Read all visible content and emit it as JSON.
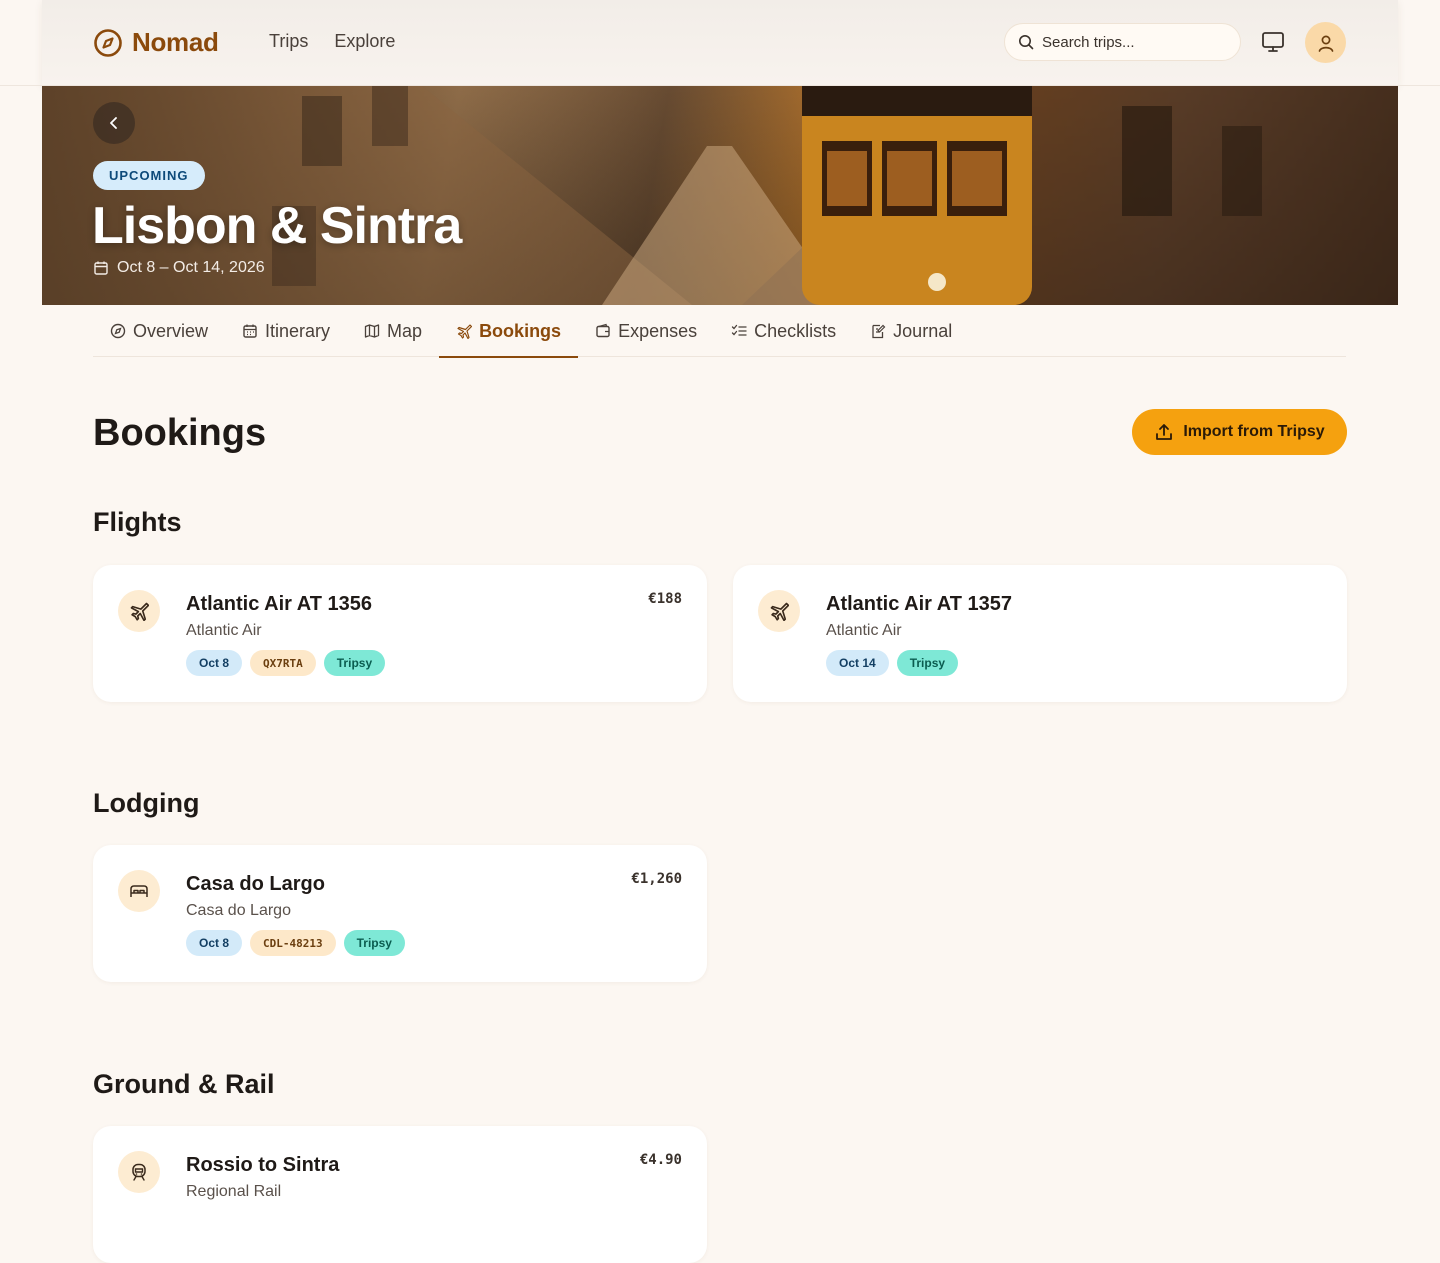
{
  "app": {
    "name": "Nomad"
  },
  "topnav": {
    "items": [
      "Trips",
      "Explore"
    ]
  },
  "search": {
    "placeholder": "Search trips..."
  },
  "hero": {
    "status": "UPCOMING",
    "title": "Lisbon & Sintra",
    "dates": "Oct 8 – Oct 14, 2026"
  },
  "tabs": [
    {
      "label": "Overview",
      "icon": "compass-icon"
    },
    {
      "label": "Itinerary",
      "icon": "calendar-icon"
    },
    {
      "label": "Map",
      "icon": "map-icon"
    },
    {
      "label": "Bookings",
      "icon": "plane-icon",
      "active": true
    },
    {
      "label": "Expenses",
      "icon": "wallet-icon"
    },
    {
      "label": "Checklists",
      "icon": "checklist-icon"
    },
    {
      "label": "Journal",
      "icon": "journal-icon"
    }
  ],
  "page": {
    "title": "Bookings",
    "import_label": "Import from Tripsy"
  },
  "sections": {
    "flights": {
      "title": "Flights",
      "items": [
        {
          "title": "Atlantic Air AT 1356",
          "sub": "Atlantic Air",
          "price": "€188",
          "date": "Oct 8",
          "code": "QX7RTA",
          "source": "Tripsy"
        },
        {
          "title": "Atlantic Air AT 1357",
          "sub": "Atlantic Air",
          "price": "",
          "date": "Oct 14",
          "source": "Tripsy"
        }
      ]
    },
    "lodging": {
      "title": "Lodging",
      "items": [
        {
          "title": "Casa do Largo",
          "sub": "Casa do Largo",
          "price": "€1,260",
          "date": "Oct 8",
          "code": "CDL-48213",
          "source": "Tripsy"
        }
      ]
    },
    "ground": {
      "title": "Ground & Rail",
      "items": [
        {
          "title": "Rossio to Sintra",
          "sub": "Regional Rail",
          "price": "€4.90"
        }
      ]
    }
  },
  "colors": {
    "brand": "#8b4a0c",
    "accent": "#f5a10f",
    "background": "#fcf7f2"
  }
}
